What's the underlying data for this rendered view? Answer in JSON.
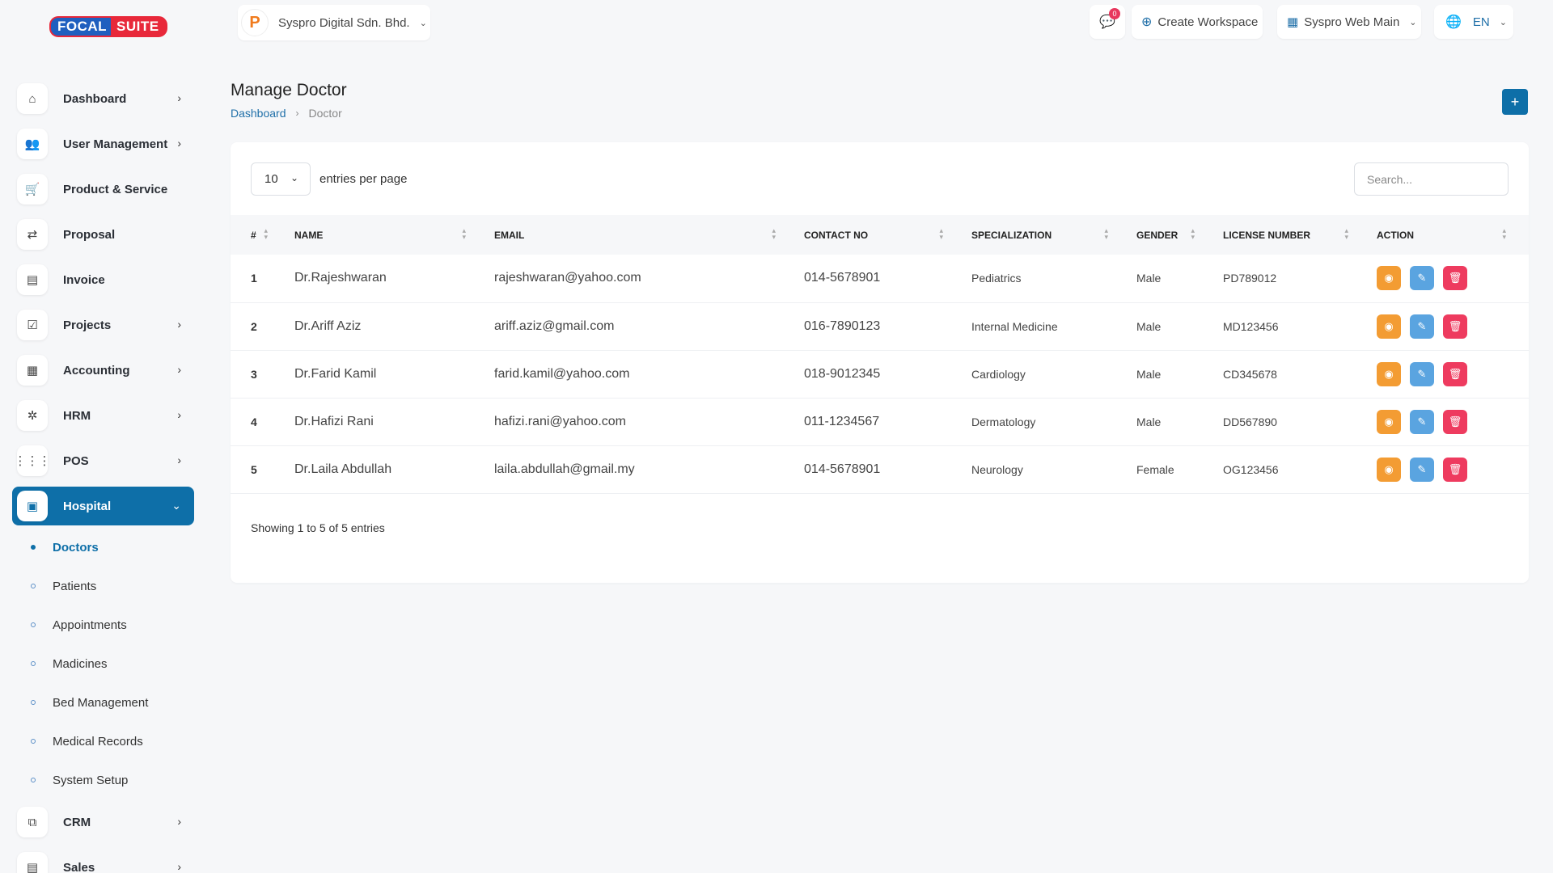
{
  "brand": {
    "part1": "FOCAL",
    "part2": "SUITE"
  },
  "topbar": {
    "company": "Syspro Digital Sdn. Bhd.",
    "message_count": "0",
    "create_workspace": "Create Workspace",
    "workspace": "Syspro Web Main",
    "language": "EN"
  },
  "sidebar": {
    "items": [
      {
        "label": "Dashboard"
      },
      {
        "label": "User Management"
      },
      {
        "label": "Product & Service"
      },
      {
        "label": "Proposal"
      },
      {
        "label": "Invoice"
      },
      {
        "label": "Projects"
      },
      {
        "label": "Accounting"
      },
      {
        "label": "HRM"
      },
      {
        "label": "POS"
      },
      {
        "label": "Hospital"
      },
      {
        "label": "CRM"
      },
      {
        "label": "Sales"
      }
    ],
    "hospital_sub": [
      {
        "label": "Doctors"
      },
      {
        "label": "Patients"
      },
      {
        "label": "Appointments"
      },
      {
        "label": "Madicines"
      },
      {
        "label": "Bed Management"
      },
      {
        "label": "Medical Records"
      },
      {
        "label": "System Setup"
      }
    ]
  },
  "page": {
    "title": "Manage Doctor",
    "breadcrumb": {
      "home": "Dashboard",
      "current": "Doctor"
    },
    "add_label": "+"
  },
  "table": {
    "page_size": "10",
    "entries_label": "entries per page",
    "search_placeholder": "Search...",
    "columns": [
      "#",
      "NAME",
      "EMAIL",
      "CONTACT NO",
      "SPECIALIZATION",
      "GENDER",
      "LICENSE NUMBER",
      "ACTION"
    ],
    "rows": [
      {
        "idx": "1",
        "name": "Dr.Rajeshwaran",
        "email": "rajeshwaran@yahoo.com",
        "contact": "014-5678901",
        "spec": "Pediatrics",
        "gender": "Male",
        "license": "PD789012"
      },
      {
        "idx": "2",
        "name": "Dr.Ariff Aziz",
        "email": "ariff.aziz@gmail.com",
        "contact": "016-7890123",
        "spec": "Internal Medicine",
        "gender": "Male",
        "license": "MD123456"
      },
      {
        "idx": "3",
        "name": "Dr.Farid Kamil",
        "email": "farid.kamil@yahoo.com",
        "contact": "018-9012345",
        "spec": "Cardiology",
        "gender": "Male",
        "license": "CD345678"
      },
      {
        "idx": "4",
        "name": "Dr.Hafizi Rani",
        "email": "hafizi.rani@yahoo.com",
        "contact": "011-1234567",
        "spec": "Dermatology",
        "gender": "Male",
        "license": "DD567890"
      },
      {
        "idx": "5",
        "name": "Dr.Laila Abdullah",
        "email": "laila.abdullah@gmail.my",
        "contact": "014-5678901",
        "spec": "Neurology",
        "gender": "Female",
        "license": "OG123456"
      }
    ],
    "footer": "Showing 1 to 5 of 5 entries"
  },
  "colors": {
    "primary": "#0e6fa8",
    "view": "#f39c33",
    "edit": "#5aa4e0",
    "delete": "#ee3b5f"
  }
}
